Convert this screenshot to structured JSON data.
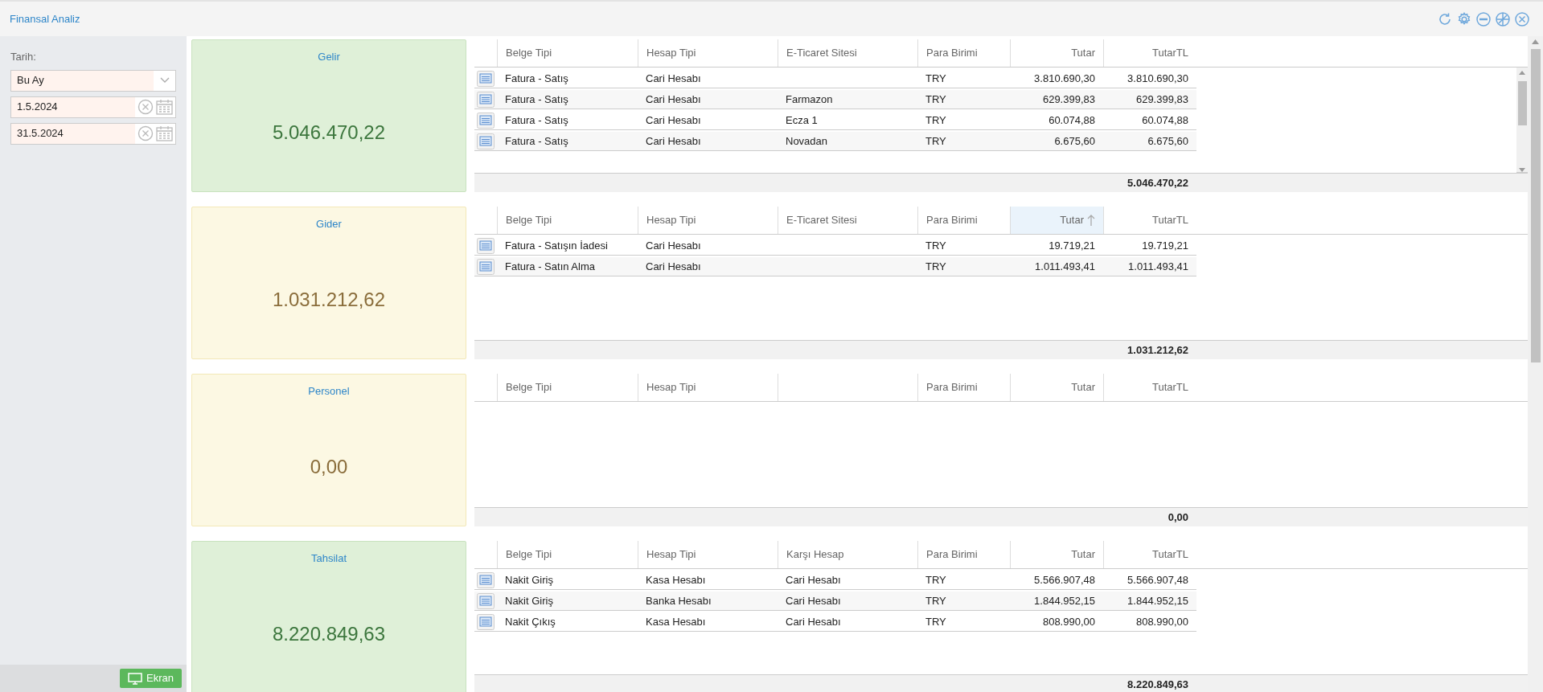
{
  "window": {
    "title": "Finansal Analiz"
  },
  "filters": {
    "label": "Tarih:",
    "period": "Bu Ay",
    "start_date": "1.5.2024",
    "end_date": "31.5.2024"
  },
  "sections": [
    {
      "title": "Gelir",
      "total": "5.046.470,22",
      "kind": "positive",
      "scrollbar": true,
      "columns": [
        {
          "label": "Belge Tipi",
          "sorted": false
        },
        {
          "label": "Hesap Tipi",
          "sorted": false
        },
        {
          "label": "E-Ticaret Sitesi",
          "sorted": false
        },
        {
          "label": "Para Birimi",
          "sorted": false
        },
        {
          "label": "Tutar",
          "sorted": false
        },
        {
          "label": "TutarTL",
          "sorted": false
        }
      ],
      "rows": [
        [
          "Fatura - Satış",
          "Cari Hesabı",
          null,
          "TRY",
          "3.810.690,30",
          "3.810.690,30"
        ],
        [
          "Fatura - Satış",
          "Cari Hesabı",
          "Farmazon",
          "TRY",
          "629.399,83",
          "629.399,83"
        ],
        [
          "Fatura - Satış",
          "Cari Hesabı",
          "Ecza 1",
          "TRY",
          "60.074,88",
          "60.074,88"
        ],
        [
          "Fatura - Satış",
          "Cari Hesabı",
          "Novadan",
          "TRY",
          "6.675,60",
          "6.675,60"
        ]
      ],
      "footer_total": "5.046.470,22"
    },
    {
      "title": "Gider",
      "total": "1.031.212,62",
      "kind": "neutral",
      "columns": [
        {
          "label": "Belge Tipi",
          "sorted": false
        },
        {
          "label": "Hesap Tipi",
          "sorted": false
        },
        {
          "label": "E-Ticaret Sitesi",
          "sorted": false
        },
        {
          "label": "Para Birimi",
          "sorted": false
        },
        {
          "label": "Tutar",
          "sorted": true
        },
        {
          "label": "TutarTL",
          "sorted": false
        }
      ],
      "rows": [
        [
          "Fatura - Satışın İadesi",
          "Cari Hesabı",
          null,
          "TRY",
          "19.719,21",
          "19.719,21"
        ],
        [
          "Fatura - Satın Alma",
          "Cari Hesabı",
          null,
          "TRY",
          "1.011.493,41",
          "1.011.493,41"
        ]
      ],
      "footer_total": "1.031.212,62"
    },
    {
      "title": "Personel",
      "total": "0,00",
      "kind": "neutral",
      "columns": [
        {
          "label": "Belge Tipi",
          "sorted": false
        },
        {
          "label": "Hesap Tipi",
          "sorted": false
        },
        null,
        {
          "label": "Para Birimi",
          "sorted": false
        },
        {
          "label": "Tutar",
          "sorted": false
        },
        {
          "label": "TutarTL",
          "sorted": false
        }
      ],
      "footer_total": "0,00"
    },
    {
      "title": "Tahsilat",
      "total": "8.220.849,63",
      "kind": "positive",
      "columns": [
        {
          "label": "Belge Tipi",
          "sorted": false
        },
        {
          "label": "Hesap Tipi",
          "sorted": false
        },
        {
          "label": "Karşı Hesap",
          "sorted": false
        },
        {
          "label": "Para Birimi",
          "sorted": false
        },
        {
          "label": "Tutar",
          "sorted": false
        },
        {
          "label": "TutarTL",
          "sorted": false
        }
      ],
      "rows": [
        [
          "Nakit Giriş",
          "Kasa Hesabı",
          "Cari Hesabı",
          "TRY",
          "5.566.907,48",
          "5.566.907,48"
        ],
        [
          "Nakit Giriş",
          "Banka Hesabı",
          "Cari Hesabı",
          "TRY",
          "1.844.952,15",
          "1.844.952,15"
        ],
        [
          "Nakit Çıkış",
          "Kasa Hesabı",
          "Cari Hesabı",
          "TRY",
          "808.990,00",
          "808.990,00"
        ]
      ],
      "footer_total": "8.220.849,63"
    }
  ],
  "screen_button": "Ekran"
}
